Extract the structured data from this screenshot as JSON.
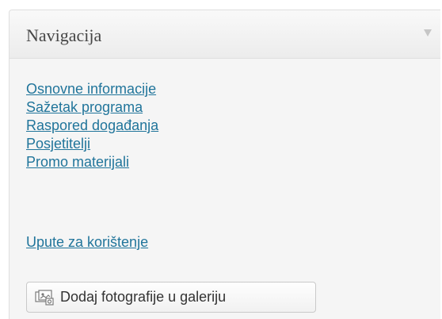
{
  "widget": {
    "title": "Navigacija",
    "links": [
      {
        "label": "Osnovne informacije"
      },
      {
        "label": "Sažetak programa"
      },
      {
        "label": "Raspored događanja"
      },
      {
        "label": "Posjetitelji"
      },
      {
        "label": "Promo materijali"
      }
    ],
    "help_link": "Upute za korištenje",
    "gallery_button": {
      "label": "Dodaj fotografije u galeriju",
      "icon": "gallery-icon"
    }
  },
  "colors": {
    "link": "#21759b",
    "title": "#464646",
    "panel_bg": "#f5f5f5",
    "border": "#dfdfdf"
  }
}
